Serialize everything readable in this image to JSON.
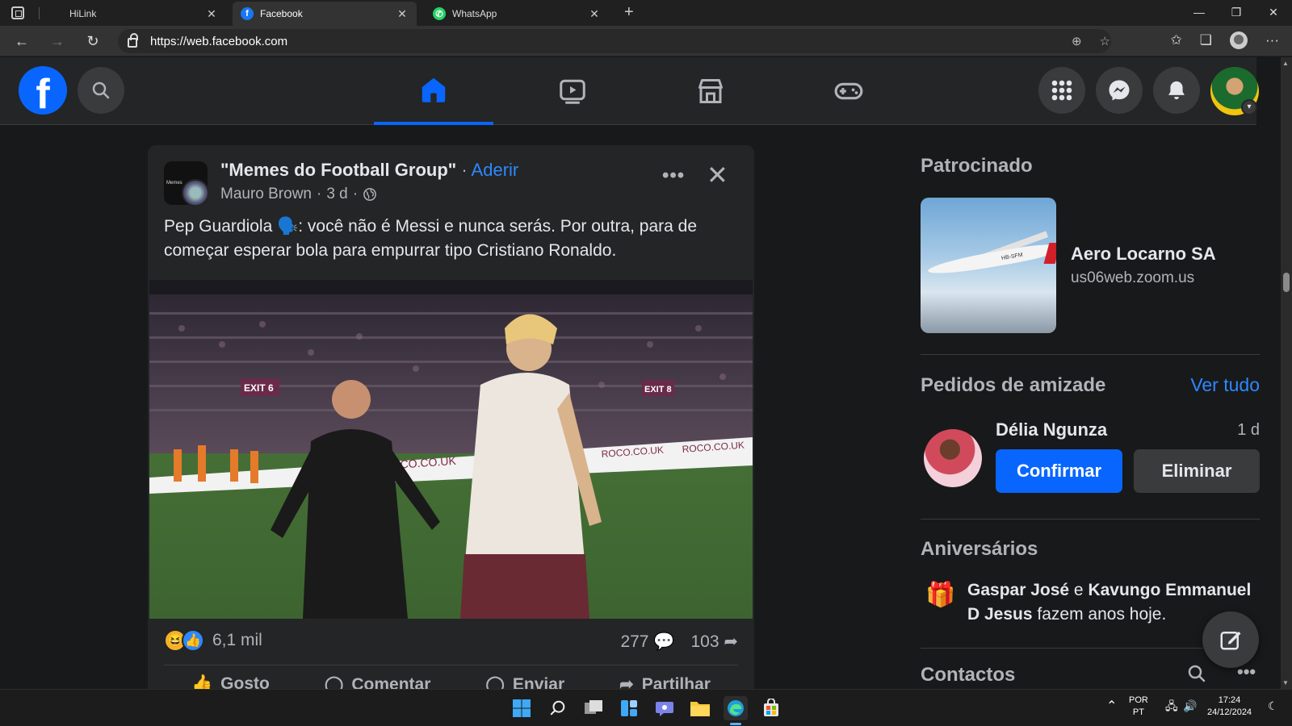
{
  "browser": {
    "tabs": [
      {
        "title": "HiLink",
        "active": false
      },
      {
        "title": "Facebook",
        "active": true
      },
      {
        "title": "WhatsApp",
        "active": false
      }
    ],
    "url": "https://web.facebook.com"
  },
  "post": {
    "group_name": "\"Memes do Football Group\"",
    "separator": " · ",
    "join_label": "Aderir",
    "author": "Mauro Brown",
    "time": "3 d",
    "avatar_text": "Memes",
    "text": "Pep Guardiola 🗣️: você não é Messi e nunca serás. Por outra, para de começar esperar bola para empurrar tipo Cristiano Ronaldo.",
    "image_signs": [
      "EXIT 6",
      "EXIT 8",
      "ROCO.CO.UK",
      "ROCO.CO.UK",
      "ROCO.CO.UK"
    ],
    "reaction_count": "6,1 mil",
    "comment_count": "277",
    "share_count": "103",
    "actions": [
      "Gosto",
      "Comentar",
      "Enviar",
      "Partilhar"
    ]
  },
  "sidebar": {
    "sponsored_title": "Patrocinado",
    "sponsor_name": "Aero Locarno SA",
    "sponsor_url": "us06web.zoom.us",
    "plane_reg": "HB-SFM",
    "friend_requests_title": "Pedidos de amizade",
    "see_all": "Ver tudo",
    "request_name": "Délia Ngunza",
    "request_time": "1 d",
    "confirm_label": "Confirmar",
    "delete_label": "Eliminar",
    "birthdays_title": "Aniversários",
    "birthday_name1": "Gaspar José",
    "birthday_and": " e ",
    "birthday_name2": "Kavungo Emmanuel D Jesus",
    "birthday_suffix": " fazem anos hoje.",
    "contacts_title": "Contactos"
  },
  "taskbar": {
    "lang_top": "POR",
    "lang_bottom": "PT",
    "time": "17:24",
    "date": "24/12/2024"
  },
  "colors": {
    "accent": "#0866ff",
    "link": "#2d88ff",
    "surface": "#242526",
    "background": "#18191a"
  }
}
